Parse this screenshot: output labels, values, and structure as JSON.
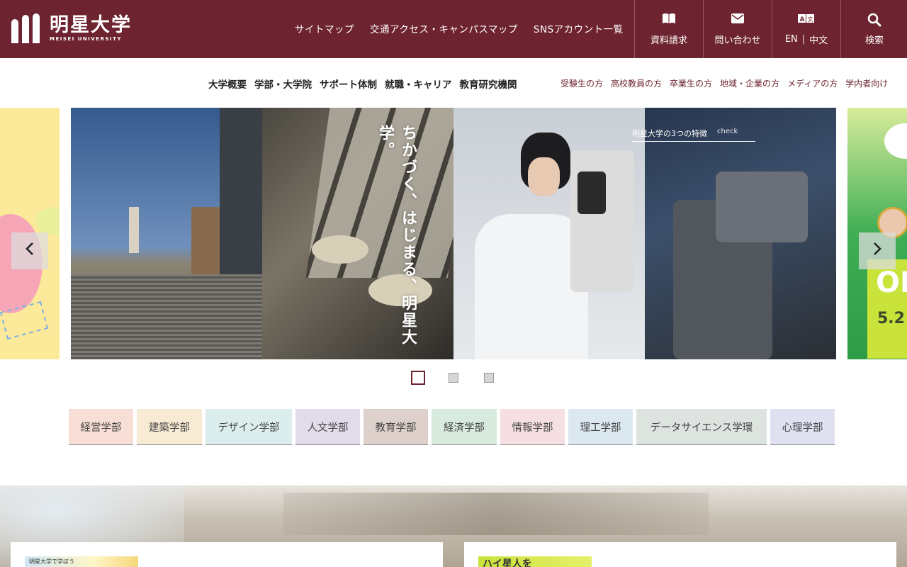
{
  "header": {
    "logo_text": "明星大学",
    "logo_sub": "MEISEI UNIVERSITY",
    "links": [
      "サイトマップ",
      "交通アクセス・キャンパスマップ",
      "SNSアカウント一覧"
    ],
    "buttons": {
      "request": {
        "label": "資料請求",
        "icon": "book-icon"
      },
      "contact": {
        "label": "問い合わせ",
        "icon": "envelope-icon"
      },
      "language": {
        "en": "EN",
        "sep": "|",
        "zh": "中文",
        "icon": "translate-icon"
      },
      "search": {
        "label": "検索",
        "icon": "search-icon"
      }
    }
  },
  "subnav": {
    "main": [
      "大学概要",
      "学部・大学院",
      "サポート体制",
      "就職・キャリア",
      "教育研究機関"
    ],
    "audience": [
      "受験生の方",
      "高校教員の方",
      "卒業生の方",
      "地域・企業の方",
      "メディアの方",
      "学内者向け"
    ]
  },
  "hero": {
    "copy": "ちかづく、はじまる、明星大学。",
    "features_link": "明星大学の3つの特徴",
    "features_check": "check",
    "side_right_oc": "OI",
    "side_right_date": "5.2",
    "prev_icon": "chevron-left-icon",
    "next_icon": "chevron-right-icon",
    "slide_count": 3,
    "active_slide": 1
  },
  "faculties": [
    {
      "label": "経営学部",
      "color": "#f7ded6",
      "width": 91
    },
    {
      "label": "建築学部",
      "color": "#f8ebd3",
      "width": 92
    },
    {
      "label": "デザイン学部",
      "color": "#dbeeed",
      "width": 122
    },
    {
      "label": "人文学部",
      "color": "#e2dcea",
      "width": 91
    },
    {
      "label": "教育学部",
      "color": "#ded1cb",
      "width": 91
    },
    {
      "label": "経済学部",
      "color": "#d9ebdf",
      "width": 92
    },
    {
      "label": "情報学部",
      "color": "#f6dfe2",
      "width": 91
    },
    {
      "label": "理工学部",
      "color": "#dce8ef",
      "width": 91
    },
    {
      "label": "データサイエンス学環",
      "color": "#dde3df",
      "width": 184
    },
    {
      "label": "心理学部",
      "color": "#dfe1f0",
      "width": 91
    }
  ],
  "cards": [
    {
      "thumb_text": "明星大学で学ぼう"
    },
    {
      "thumb_text": "ハイ星人を"
    }
  ]
}
